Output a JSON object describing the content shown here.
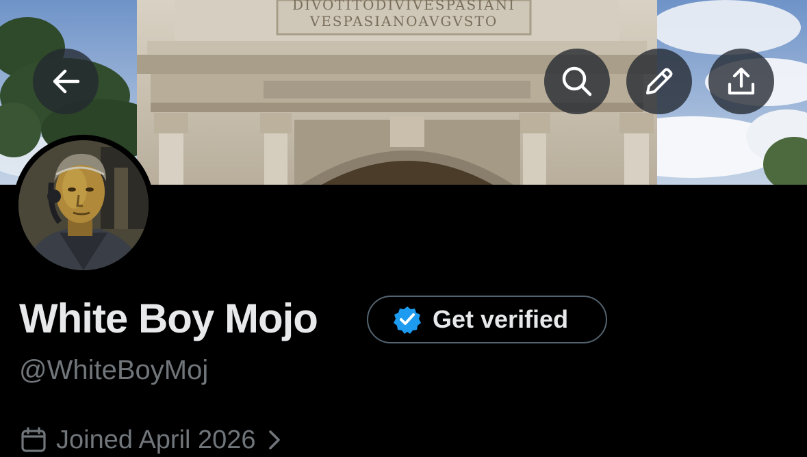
{
  "header": {
    "back_icon": "arrow-left-icon",
    "search_icon": "search-icon",
    "edit_icon": "pencil-icon",
    "share_icon": "share-upload-icon"
  },
  "banner": {
    "inscription_line1": "DIVOTITODIVIVESPASIANI",
    "inscription_line2": "VESPASIANOAVGVSTO"
  },
  "profile": {
    "display_name": "White Boy Mojo",
    "handle": "@WhiteBoyMoj",
    "verify_button_label": "Get verified",
    "verify_icon": "verified-badge-icon",
    "joined_text": "Joined April 2026",
    "joined_icon": "calendar-icon",
    "joined_chevron": "chevron-right-icon"
  },
  "colors": {
    "background": "#000000",
    "primary_text": "#e7e9ea",
    "secondary_text": "#71767b",
    "verified_blue": "#1d9bf0",
    "button_border": "#536471"
  }
}
